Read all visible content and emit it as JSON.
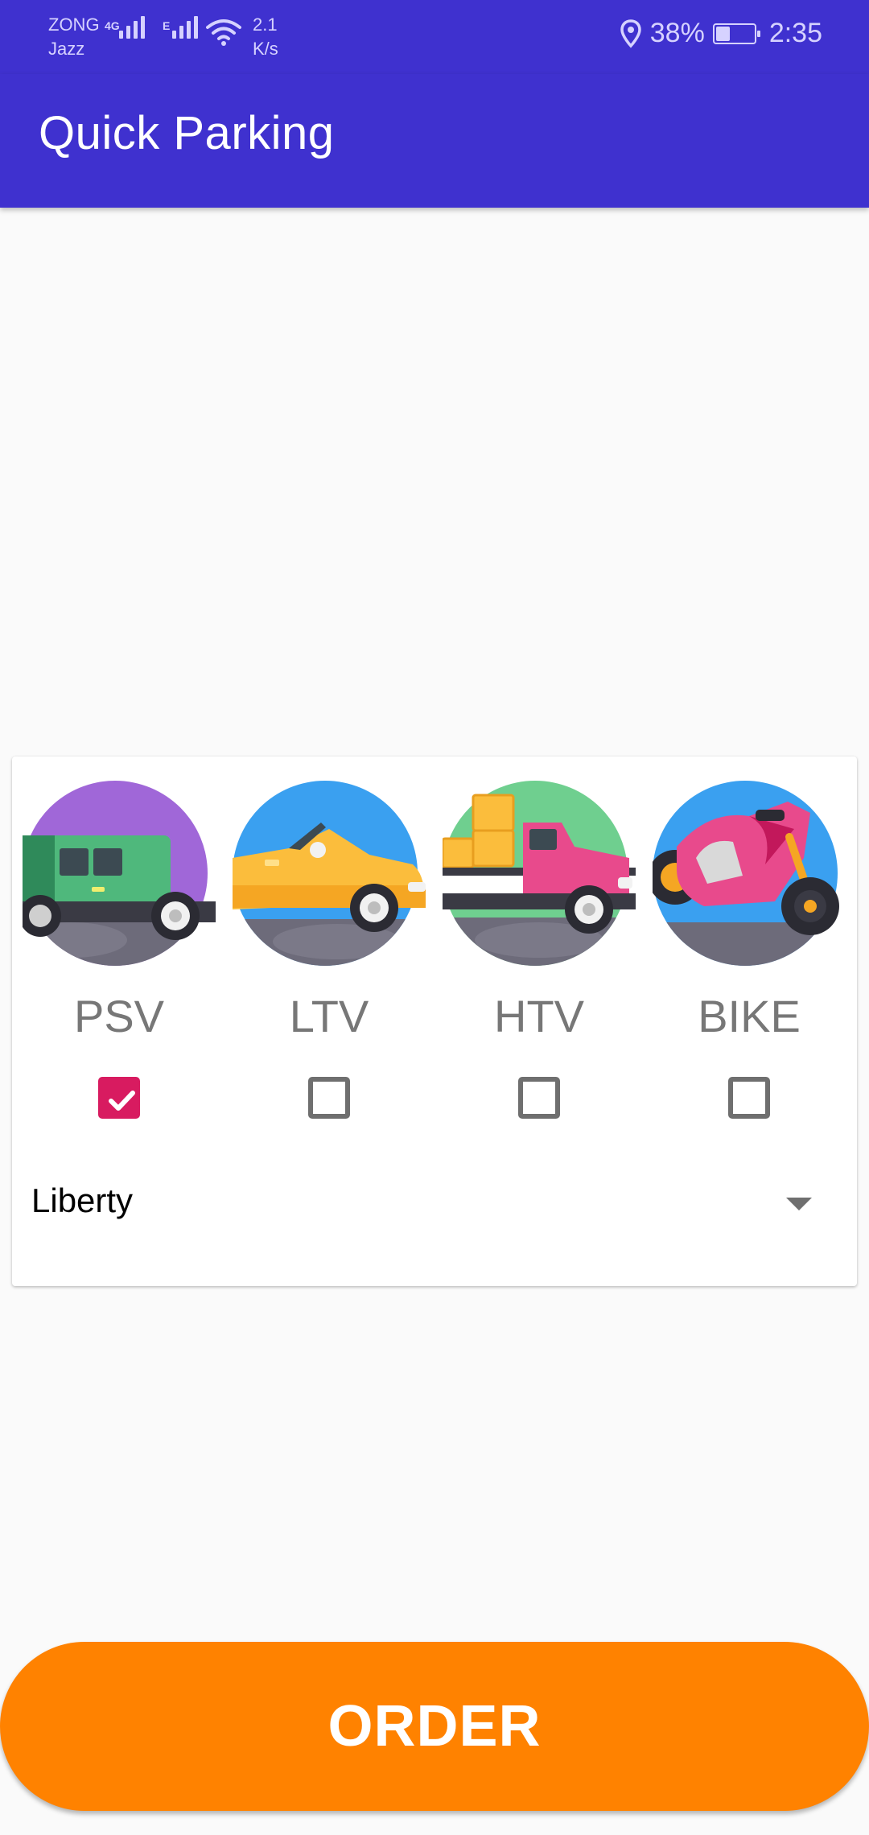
{
  "status_bar": {
    "carrier_1": "ZONG",
    "carrier_2": "Jazz",
    "network_1": "4G",
    "network_2": "E",
    "speed_value": "2.1",
    "speed_unit": "K/s",
    "battery": "38%",
    "battery_fraction": 0.38,
    "time": "2:35",
    "icons": [
      "signal-icon",
      "signal-icon",
      "wifi-icon",
      "location-icon",
      "battery-icon"
    ]
  },
  "app_bar": {
    "title": "Quick Parking"
  },
  "vehicles": [
    {
      "label": "PSV",
      "checked": true,
      "icon": "jeep-icon"
    },
    {
      "label": "LTV",
      "checked": false,
      "icon": "car-icon"
    },
    {
      "label": "HTV",
      "checked": false,
      "icon": "truck-icon"
    },
    {
      "label": "BIKE",
      "checked": false,
      "icon": "motorbike-icon"
    }
  ],
  "location_spinner": {
    "selected": "Liberty"
  },
  "order_button": {
    "label": "ORDER"
  },
  "colors": {
    "primary": "#3f31cf",
    "accent": "#d81b60",
    "order": "#ff8200"
  }
}
